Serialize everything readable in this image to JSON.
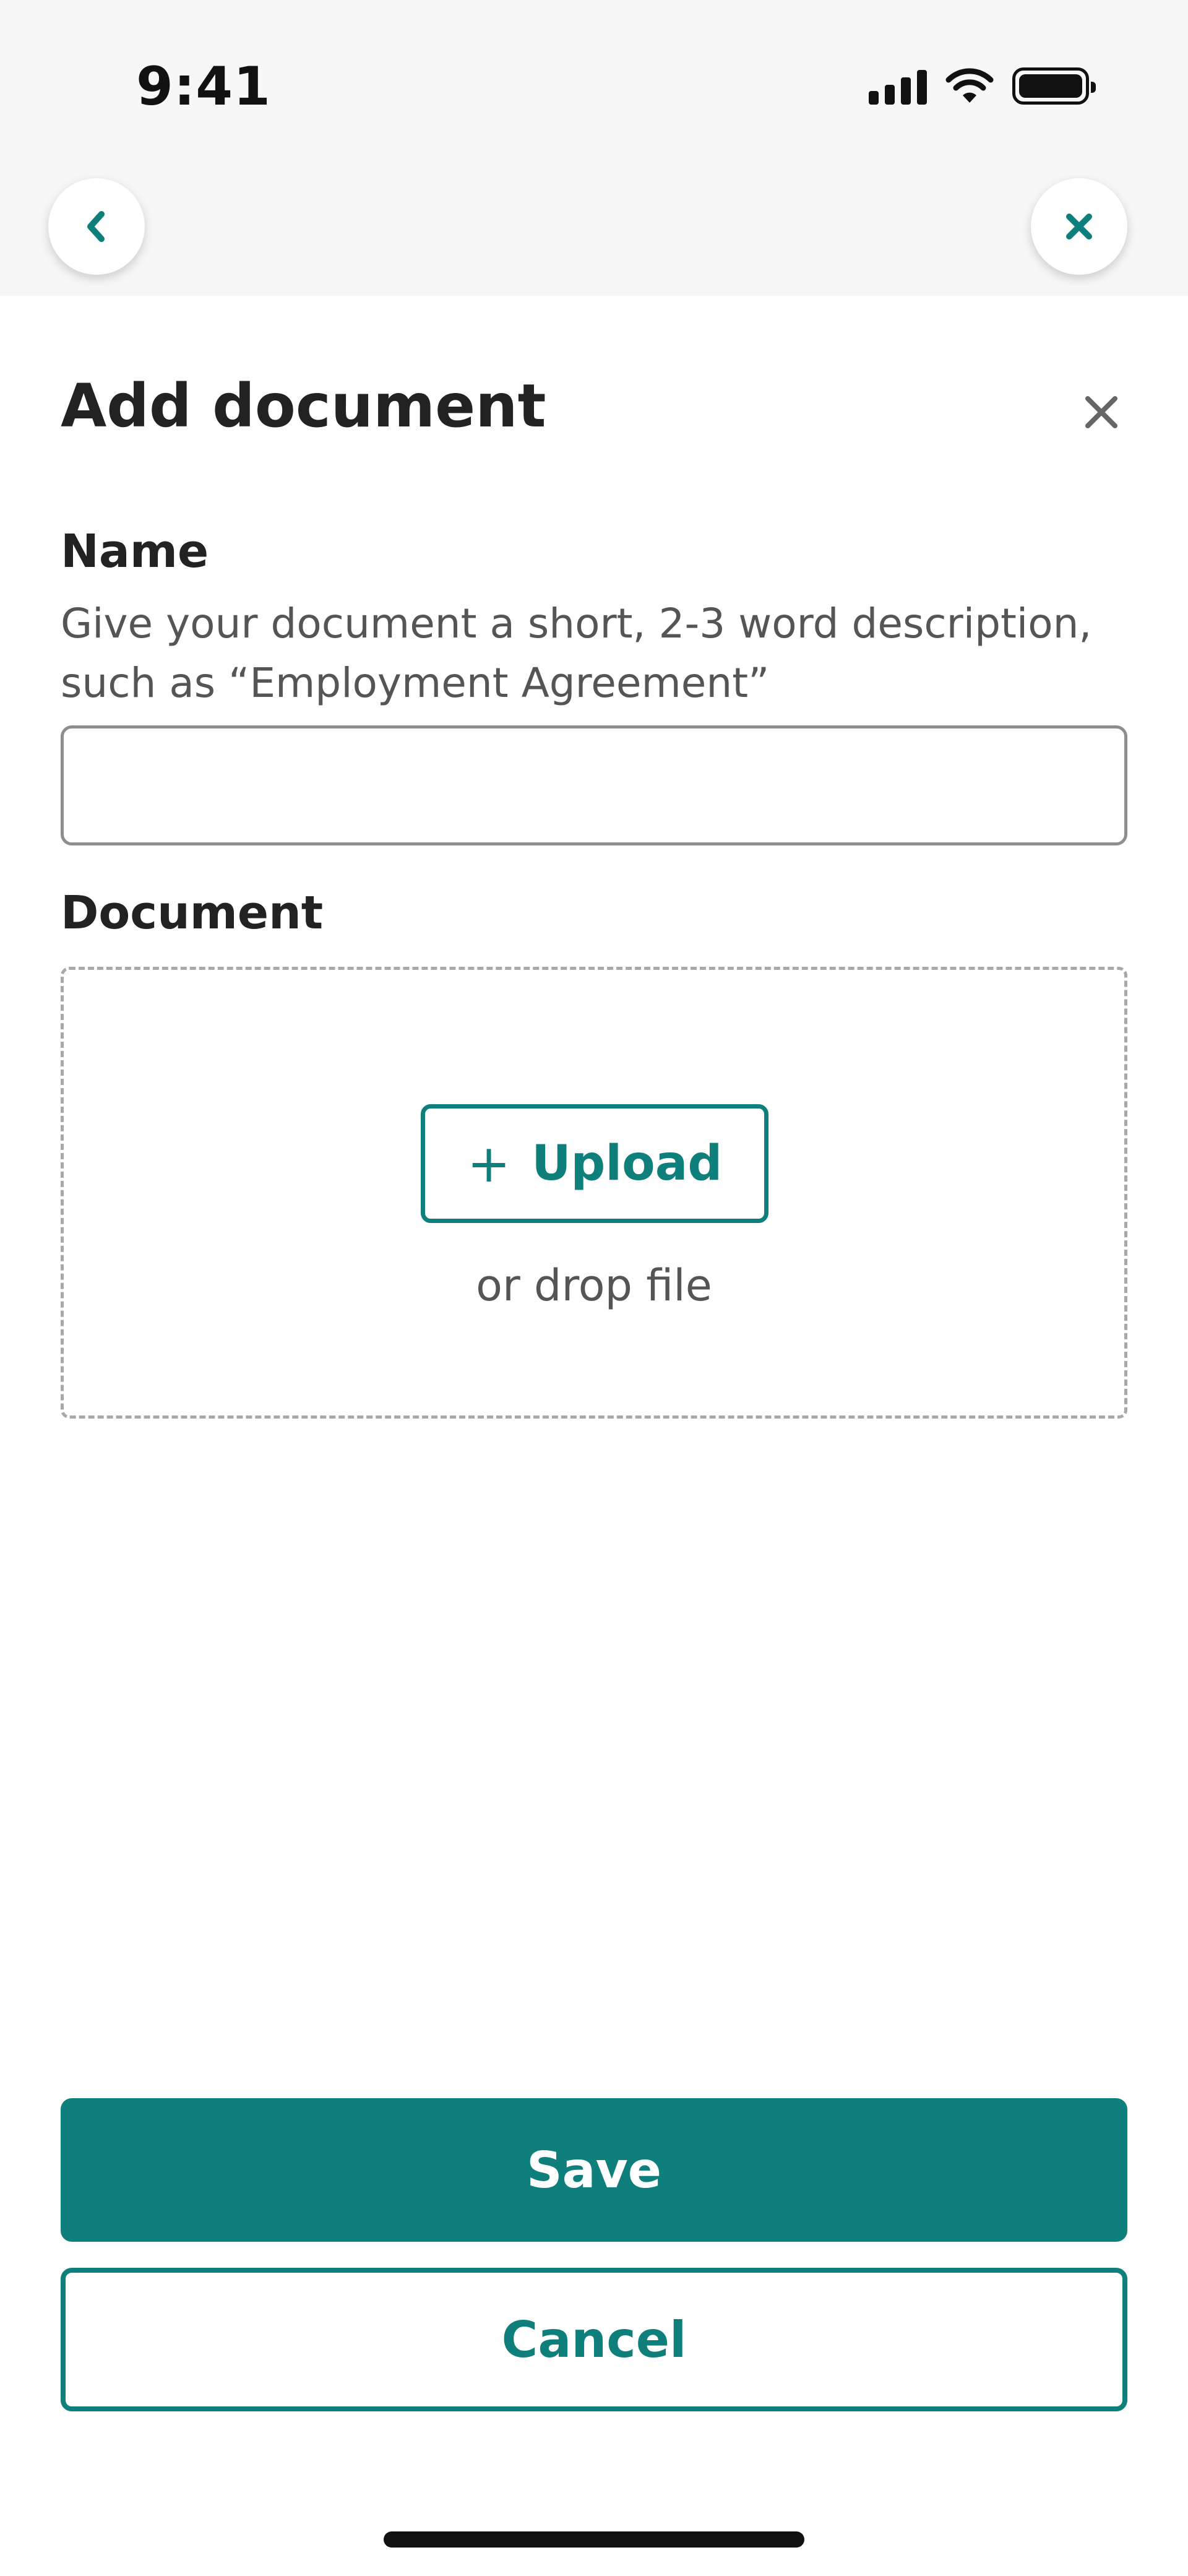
{
  "status_bar": {
    "time": "9:41"
  },
  "nav": {
    "back_icon": "chevron-left-icon",
    "close_icon": "close-icon"
  },
  "modal": {
    "title": "Add document",
    "close_icon": "close-icon"
  },
  "name_field": {
    "label": "Name",
    "helper": "Give your document a short, 2-3 word description, such as “Employment Agreement”",
    "value": "",
    "placeholder": ""
  },
  "document_field": {
    "label": "Document",
    "upload_label": "Upload",
    "upload_icon": "plus-icon",
    "drop_text": "or drop file"
  },
  "actions": {
    "save_label": "Save",
    "cancel_label": "Cancel"
  },
  "colors": {
    "accent": "#0e7f7b",
    "text": "#222222",
    "muted": "#555555"
  }
}
